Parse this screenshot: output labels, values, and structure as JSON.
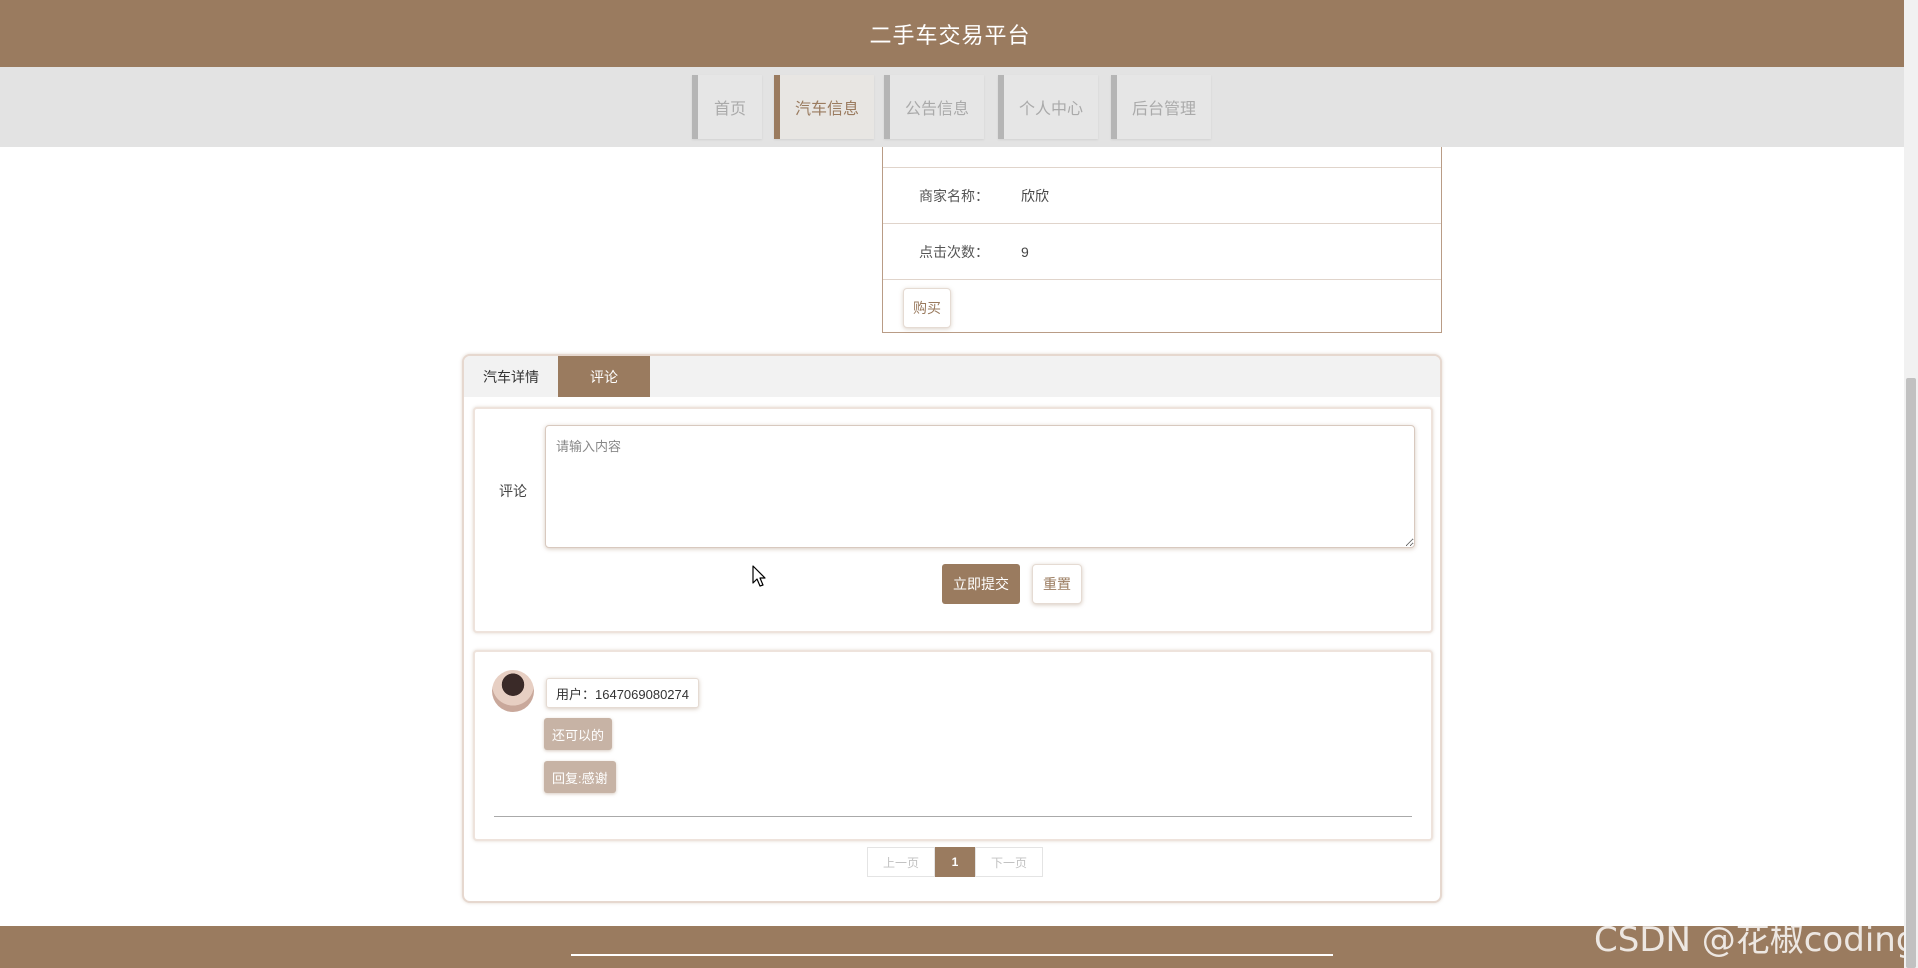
{
  "header": {
    "title": "二手车交易平台"
  },
  "nav": {
    "items": [
      {
        "label": "首页",
        "active": false
      },
      {
        "label": "汽车信息",
        "active": true
      },
      {
        "label": "公告信息",
        "active": false
      },
      {
        "label": "个人中心",
        "active": false
      },
      {
        "label": "后台管理",
        "active": false
      }
    ]
  },
  "details": {
    "rows": [
      {
        "key": "商家名称：",
        "value": "欣欣"
      },
      {
        "key": "点击次数：",
        "value": "9"
      }
    ],
    "buy_label": "购买"
  },
  "tabs": [
    {
      "label": "汽车详情",
      "active": false
    },
    {
      "label": "评论",
      "active": true
    }
  ],
  "comment_form": {
    "label": "评论",
    "placeholder": "请输入内容",
    "value": "",
    "submit_label": "立即提交",
    "reset_label": "重置"
  },
  "comments": [
    {
      "user_text": "用户：1647069080274",
      "content": "还可以的",
      "reply": "回复:感谢"
    }
  ],
  "pagination": {
    "prev": "上一页",
    "current": "1",
    "next": "下一页"
  },
  "watermark": "CSDN @花椒coding",
  "colors": {
    "brand": "#9a7b5f",
    "bubble": "#c7b3a5",
    "nav_bg": "#e3e3e3"
  },
  "icons": {
    "cursor": "arrow-cursor-icon",
    "avatar": "user-avatar"
  }
}
